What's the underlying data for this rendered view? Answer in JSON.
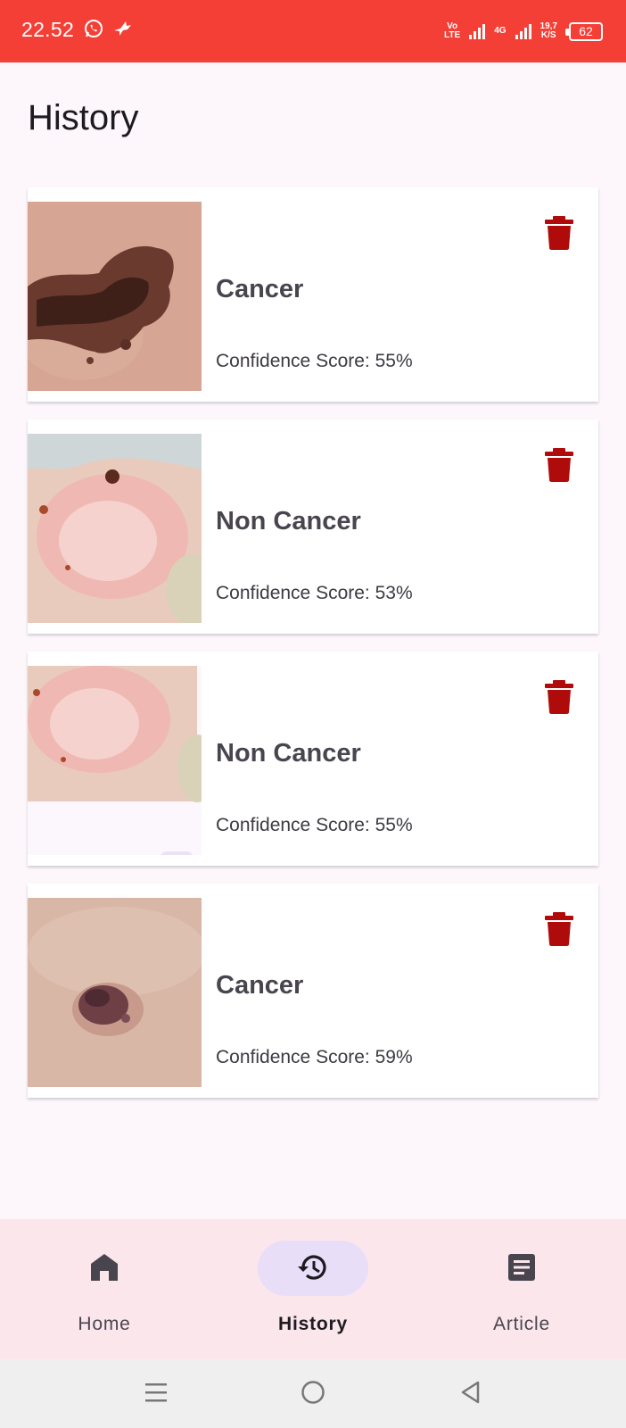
{
  "status_bar": {
    "time": "22.52",
    "volte_top": "Vo",
    "volte_bottom": "LTE",
    "network_type": "4G",
    "speed_value": "19,7",
    "speed_unit": "K/S",
    "battery": "62",
    "color": "#f33f36"
  },
  "page": {
    "title": "History"
  },
  "history": [
    {
      "label": "Cancer",
      "confidence": "Confidence Score: 55%",
      "image": "mole-dark-irregular"
    },
    {
      "label": "Non Cancer",
      "confidence": "Confidence Score: 53%",
      "image": "skin-lesion-pink-crusted"
    },
    {
      "label": "Non Cancer",
      "confidence": "Confidence Score: 55%",
      "image": "skin-lesion-pink-crusted"
    },
    {
      "label": "Cancer",
      "confidence": "Confidence Score: 59%",
      "image": "mole-small-dark"
    }
  ],
  "card_actions": {
    "delete_icon": "trash-icon",
    "delete_color": "#b00b0b"
  },
  "bottom_nav": {
    "items": [
      {
        "label": "Home",
        "icon": "home-icon",
        "active": false
      },
      {
        "label": "History",
        "icon": "history-icon",
        "active": true
      },
      {
        "label": "Article",
        "icon": "article-icon",
        "active": false
      }
    ]
  },
  "system_nav": {
    "icons": [
      "menu-icon",
      "home-circle-icon",
      "back-icon"
    ]
  }
}
